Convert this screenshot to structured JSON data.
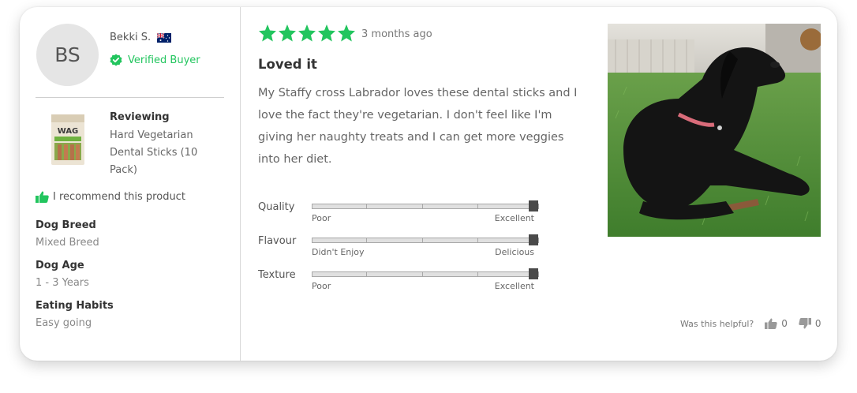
{
  "reviewer": {
    "initials": "BS",
    "name": "Bekki S.",
    "verified_label": "Verified Buyer"
  },
  "product": {
    "reviewing_label": "Reviewing",
    "name": "Hard Vegetarian Dental Sticks (10 Pack)",
    "package_brand": "WAG"
  },
  "recommend_text": "I recommend this product",
  "attributes": [
    {
      "label": "Dog Breed",
      "value": "Mixed Breed"
    },
    {
      "label": "Dog Age",
      "value": "1 - 3 Years"
    },
    {
      "label": "Eating Habits",
      "value": "Easy going"
    }
  ],
  "review": {
    "rating": 5,
    "time_ago": "3 months ago",
    "title": "Loved it",
    "body": "My Staffy cross Labrador loves these dental sticks and I love the fact they're vegetarian. I don't feel like I'm giving her naughty treats and I can get more veggies into her diet."
  },
  "ratings": [
    {
      "label": "Quality",
      "min_label": "Poor",
      "max_label": "Excellent",
      "value": 1.0
    },
    {
      "label": "Flavour",
      "min_label": "Didn't Enjoy",
      "max_label": "Delicious",
      "value": 1.0
    },
    {
      "label": "Texture",
      "min_label": "Poor",
      "max_label": "Excellent",
      "value": 1.0
    }
  ],
  "helpful": {
    "label": "Was this helpful?",
    "up_count": "0",
    "down_count": "0"
  },
  "colors": {
    "star": "#22c55e",
    "verified": "#22c55e",
    "thumb": "#4a4a4a"
  }
}
